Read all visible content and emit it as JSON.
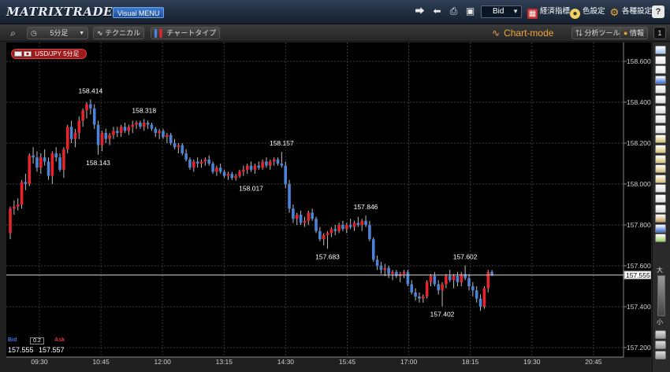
{
  "app": {
    "title": "MATRIXTRADER",
    "menu_label": "Visual MENU"
  },
  "titlebar": {
    "price_type": "Bid",
    "economic_label": "経済指標",
    "color_label": "色設定",
    "settings_label": "各種設定",
    "help_label": "?"
  },
  "toolbar": {
    "timeframe": "5分足",
    "technical_label": "テクニカル",
    "chart_type_label": "チャートタイプ",
    "mode_label": "Chart-mode",
    "analysis_label": "分析ツール",
    "info_label": "情報",
    "panel_number": "1"
  },
  "symbol": {
    "label": "USD/JPY 5分足"
  },
  "quote": {
    "bid_label": "Bid",
    "ask_label": "Ask",
    "spread": "0.2",
    "bid": "157.555",
    "ask": "157.557"
  },
  "palette": {
    "large_label": "大",
    "small_label": "小"
  },
  "chart_data": {
    "type": "candlestick",
    "symbol": "USD/JPY",
    "timeframe": "5分足",
    "y_ticks": [
      "158.600",
      "158.400",
      "158.200",
      "158.000",
      "157.800",
      "157.600",
      "157.400",
      "157.200"
    ],
    "ylim": [
      157.15,
      158.65
    ],
    "x_ticks": [
      "09:30",
      "10:45",
      "12:00",
      "13:15",
      "14:30",
      "15:45",
      "17:00",
      "18:15",
      "19:30",
      "20:45"
    ],
    "current_price": "157.555",
    "current_price_value": 157.555,
    "annotations": [
      {
        "label": "158.414",
        "value": 158.414,
        "index": 21,
        "kind": "high"
      },
      {
        "label": "158.143",
        "value": 158.143,
        "index": 23,
        "kind": "low"
      },
      {
        "label": "158.318",
        "value": 158.318,
        "index": 35,
        "kind": "high"
      },
      {
        "label": "158.157",
        "value": 158.157,
        "index": 71,
        "kind": "high"
      },
      {
        "label": "158.017",
        "value": 158.017,
        "index": 63,
        "kind": "low"
      },
      {
        "label": "157.846",
        "value": 157.846,
        "index": 93,
        "kind": "high"
      },
      {
        "label": "157.683",
        "value": 157.683,
        "index": 83,
        "kind": "low"
      },
      {
        "label": "157.602",
        "value": 157.602,
        "index": 119,
        "kind": "high"
      },
      {
        "label": "157.402",
        "value": 157.402,
        "index": 113,
        "kind": "low"
      }
    ],
    "colors": {
      "up": "#e8232a",
      "down": "#4a83d8",
      "grid": "#3a3a3a",
      "axis_text": "#d0d0d0",
      "label": "#ffffff"
    },
    "candles": [
      [
        157.76,
        157.89,
        157.73,
        157.88
      ],
      [
        157.88,
        157.92,
        157.85,
        157.89
      ],
      [
        157.89,
        157.93,
        157.87,
        157.9
      ],
      [
        157.9,
        158.02,
        157.88,
        158.01
      ],
      [
        158.01,
        158.05,
        157.97,
        158.0
      ],
      [
        158.0,
        158.15,
        157.99,
        158.14
      ],
      [
        158.14,
        158.18,
        158.1,
        158.13
      ],
      [
        158.13,
        158.16,
        158.06,
        158.08
      ],
      [
        158.08,
        158.15,
        158.05,
        158.13
      ],
      [
        158.13,
        158.17,
        158.09,
        158.11
      ],
      [
        158.11,
        158.13,
        158.02,
        158.04
      ],
      [
        158.04,
        158.16,
        158.0,
        158.15
      ],
      [
        158.15,
        158.18,
        158.11,
        158.13
      ],
      [
        158.13,
        158.15,
        158.06,
        158.07
      ],
      [
        158.07,
        158.18,
        158.03,
        158.17
      ],
      [
        158.17,
        158.29,
        158.15,
        158.28
      ],
      [
        158.28,
        158.31,
        158.2,
        158.22
      ],
      [
        158.22,
        158.27,
        158.18,
        158.25
      ],
      [
        158.25,
        158.33,
        158.22,
        158.31
      ],
      [
        158.31,
        158.37,
        158.28,
        158.36
      ],
      [
        158.36,
        158.4,
        158.32,
        158.39
      ],
      [
        158.39,
        158.414,
        158.34,
        158.37
      ],
      [
        158.37,
        158.39,
        158.27,
        158.29
      ],
      [
        158.29,
        158.31,
        158.143,
        158.19
      ],
      [
        158.19,
        158.26,
        158.16,
        158.25
      ],
      [
        158.25,
        158.27,
        158.2,
        158.22
      ],
      [
        158.22,
        158.25,
        158.19,
        158.24
      ],
      [
        158.24,
        158.28,
        158.22,
        158.26
      ],
      [
        158.26,
        158.28,
        158.23,
        158.25
      ],
      [
        158.25,
        158.29,
        158.23,
        158.28
      ],
      [
        158.28,
        158.3,
        158.25,
        158.26
      ],
      [
        158.26,
        158.29,
        158.24,
        158.28
      ],
      [
        158.28,
        158.31,
        158.25,
        158.29
      ],
      [
        158.29,
        158.31,
        158.27,
        158.3
      ],
      [
        158.3,
        158.31,
        158.27,
        158.28
      ],
      [
        158.28,
        158.318,
        158.26,
        158.3
      ],
      [
        158.3,
        158.31,
        158.27,
        158.29
      ],
      [
        158.29,
        158.3,
        158.26,
        158.27
      ],
      [
        158.27,
        158.28,
        158.23,
        158.25
      ],
      [
        158.25,
        158.27,
        158.22,
        158.26
      ],
      [
        158.26,
        158.27,
        158.22,
        158.23
      ],
      [
        158.23,
        158.25,
        158.2,
        158.24
      ],
      [
        158.24,
        158.25,
        158.19,
        158.2
      ],
      [
        158.2,
        158.22,
        158.17,
        158.18
      ],
      [
        158.18,
        158.2,
        158.15,
        158.19
      ],
      [
        158.19,
        158.2,
        158.14,
        158.15
      ],
      [
        158.15,
        158.17,
        158.11,
        158.12
      ],
      [
        158.12,
        158.13,
        158.07,
        158.08
      ],
      [
        158.08,
        158.12,
        158.06,
        158.11
      ],
      [
        158.11,
        158.13,
        158.08,
        158.1
      ],
      [
        158.1,
        158.12,
        158.08,
        158.11
      ],
      [
        158.11,
        158.13,
        158.09,
        158.12
      ],
      [
        158.12,
        158.14,
        158.09,
        158.1
      ],
      [
        158.1,
        158.11,
        158.05,
        158.06
      ],
      [
        158.06,
        158.09,
        158.04,
        158.08
      ],
      [
        158.08,
        158.1,
        158.05,
        158.06
      ],
      [
        158.06,
        158.07,
        158.03,
        158.04
      ],
      [
        158.04,
        158.06,
        158.02,
        158.05
      ],
      [
        158.05,
        158.06,
        158.02,
        158.03
      ],
      [
        158.03,
        158.05,
        158.017,
        158.04
      ],
      [
        158.04,
        158.07,
        158.03,
        158.06
      ],
      [
        158.06,
        158.09,
        158.04,
        158.07
      ],
      [
        158.07,
        158.1,
        158.05,
        158.09
      ],
      [
        158.09,
        158.11,
        158.06,
        158.07
      ],
      [
        158.07,
        158.1,
        158.05,
        158.09
      ],
      [
        158.09,
        158.11,
        158.07,
        158.08
      ],
      [
        158.08,
        158.12,
        158.07,
        158.11
      ],
      [
        158.11,
        158.13,
        158.08,
        158.09
      ],
      [
        158.09,
        158.12,
        158.07,
        158.11
      ],
      [
        158.11,
        158.13,
        158.09,
        158.12
      ],
      [
        158.12,
        158.13,
        158.09,
        158.1
      ],
      [
        158.1,
        158.157,
        158.08,
        158.09
      ],
      [
        158.09,
        158.11,
        157.98,
        158.0
      ],
      [
        158.0,
        158.02,
        157.86,
        157.88
      ],
      [
        157.88,
        157.9,
        157.81,
        157.83
      ],
      [
        157.83,
        157.86,
        157.8,
        157.85
      ],
      [
        157.85,
        157.87,
        157.8,
        157.81
      ],
      [
        157.81,
        157.84,
        157.79,
        157.82
      ],
      [
        157.82,
        157.87,
        157.8,
        157.86
      ],
      [
        157.86,
        157.88,
        157.82,
        157.83
      ],
      [
        157.83,
        157.84,
        157.76,
        157.77
      ],
      [
        157.77,
        157.79,
        157.72,
        157.73
      ],
      [
        157.73,
        157.76,
        157.7,
        157.75
      ],
      [
        157.75,
        157.77,
        157.683,
        157.76
      ],
      [
        157.76,
        157.79,
        157.74,
        157.78
      ],
      [
        157.78,
        157.8,
        157.75,
        157.77
      ],
      [
        157.77,
        157.81,
        157.76,
        157.8
      ],
      [
        157.8,
        157.82,
        157.77,
        157.78
      ],
      [
        157.78,
        157.81,
        157.76,
        157.8
      ],
      [
        157.8,
        157.83,
        157.78,
        157.79
      ],
      [
        157.79,
        157.82,
        157.77,
        157.81
      ],
      [
        157.81,
        157.84,
        157.79,
        157.8
      ],
      [
        157.8,
        157.83,
        157.77,
        157.82
      ],
      [
        157.82,
        157.846,
        157.79,
        157.8
      ],
      [
        157.8,
        157.82,
        157.72,
        157.73
      ],
      [
        157.73,
        157.74,
        157.62,
        157.63
      ],
      [
        157.63,
        157.65,
        157.58,
        157.6
      ],
      [
        157.6,
        157.62,
        157.56,
        157.58
      ],
      [
        157.58,
        157.61,
        157.55,
        157.59
      ],
      [
        157.59,
        157.6,
        157.54,
        157.56
      ],
      [
        157.56,
        157.58,
        157.53,
        157.57
      ],
      [
        157.57,
        157.58,
        157.54,
        157.55
      ],
      [
        157.55,
        157.57,
        157.52,
        157.56
      ],
      [
        157.56,
        157.58,
        157.54,
        157.57
      ],
      [
        157.57,
        157.58,
        157.5,
        157.51
      ],
      [
        157.51,
        157.53,
        157.46,
        157.47
      ],
      [
        157.47,
        157.49,
        157.43,
        157.45
      ],
      [
        157.45,
        157.47,
        157.42,
        157.44
      ],
      [
        157.44,
        157.46,
        157.42,
        157.45
      ],
      [
        157.45,
        157.53,
        157.44,
        157.52
      ],
      [
        157.52,
        157.56,
        157.5,
        157.55
      ],
      [
        157.55,
        157.57,
        157.5,
        157.51
      ],
      [
        157.51,
        157.53,
        157.46,
        157.48
      ],
      [
        157.48,
        157.52,
        157.402,
        157.51
      ],
      [
        157.51,
        157.56,
        157.49,
        157.55
      ],
      [
        157.55,
        157.58,
        157.52,
        157.53
      ],
      [
        157.53,
        157.56,
        157.49,
        157.55
      ],
      [
        157.55,
        157.57,
        157.5,
        157.52
      ],
      [
        157.52,
        157.57,
        157.5,
        157.56
      ],
      [
        157.56,
        157.602,
        157.53,
        157.54
      ],
      [
        157.54,
        157.56,
        157.48,
        157.5
      ],
      [
        157.5,
        157.52,
        157.45,
        157.48
      ],
      [
        157.48,
        157.5,
        157.42,
        157.44
      ],
      [
        157.44,
        157.46,
        157.38,
        157.4
      ],
      [
        157.4,
        157.5,
        157.39,
        157.49
      ],
      [
        157.49,
        157.58,
        157.47,
        157.57
      ],
      [
        157.57,
        157.58,
        157.55,
        157.555
      ]
    ]
  }
}
